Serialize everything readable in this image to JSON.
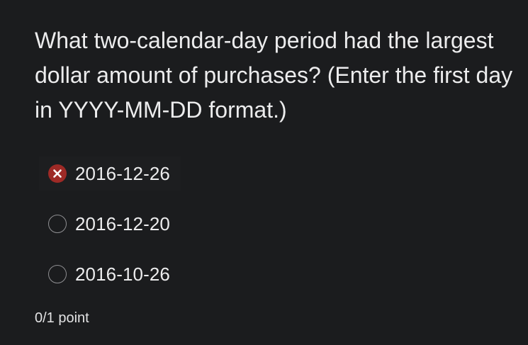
{
  "question": {
    "text": "What two-calendar-day period had the largest dollar amount of purchases? (Enter the first day in YYYY-MM-DD format.)"
  },
  "options": [
    {
      "label": "2016-12-26",
      "state": "selected-incorrect"
    },
    {
      "label": "2016-12-20",
      "state": "unselected"
    },
    {
      "label": "2016-10-26",
      "state": "unselected"
    }
  ],
  "score": {
    "text": "0/1 point"
  },
  "colors": {
    "background": "#1b1c1e",
    "text": "#ececed",
    "incorrect": "#9e2a26",
    "radio_border": "#8f8f92"
  }
}
